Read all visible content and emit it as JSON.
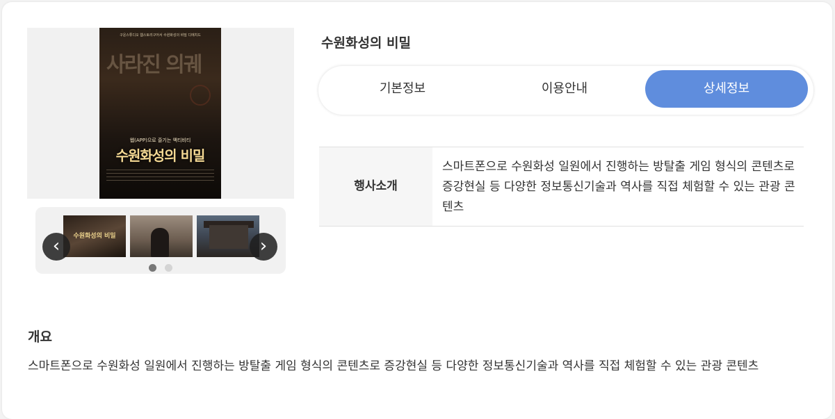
{
  "gallery": {
    "poster": {
      "top_line": "구운스튜디오 웹스토리구어서 수원화성의 비밀 디에치드",
      "big_title": "사라진 의궤",
      "tagline": "웹(APP)으로 즐기는 액티비티",
      "title": "수원화성의 비밀"
    },
    "thumbnails": [
      {
        "label": "수원화성의 비밀"
      },
      {
        "label": ""
      },
      {
        "label": ""
      }
    ],
    "prev_icon": "chevron-left-icon",
    "next_icon": "chevron-right-icon",
    "dot_count": 2,
    "active_dot": 1
  },
  "page": {
    "title": "수원화성의 비밀"
  },
  "tabs": [
    {
      "label": "기본정보"
    },
    {
      "label": "이용안내"
    },
    {
      "label": "상세정보",
      "active": true
    }
  ],
  "detail": {
    "head": "행사소개",
    "body": "스마트폰으로 수원화성 일원에서 진행하는 방탈출 게임 형식의 콘텐츠로 증강현실 등 다양한 정보통신기술과 역사를 직접 체험할 수 있는 관광 콘텐츠"
  },
  "overview": {
    "title": "개요",
    "body": "스마트폰으로 수원화성 일원에서 진행하는 방탈출 게임 형식의 콘텐츠로 증강현실 등 다양한 정보통신기술과 역사를 직접 체험할 수 있는 관광 콘텐츠"
  },
  "colors": {
    "active_tab": "#5f8ddd",
    "background": "#ffffff"
  }
}
